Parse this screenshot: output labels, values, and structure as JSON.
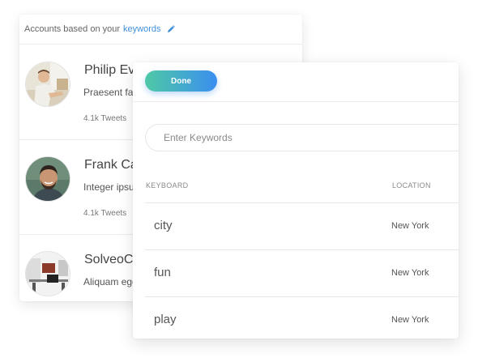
{
  "accounts": {
    "header_prefix": "Accounts based on your",
    "header_link": "keywords",
    "items": [
      {
        "name": "Philip Ev",
        "desc": "Praesent fa",
        "tweets": "4.1k Tweets"
      },
      {
        "name": "Frank Ca",
        "desc": "Integer ipsu",
        "tweets": "4.1k Tweets"
      },
      {
        "name": "SolveoC",
        "desc": "Aliquam ege",
        "tweets": ""
      }
    ]
  },
  "keywords_panel": {
    "done_label": "Done",
    "input_placeholder": "Enter Keywords",
    "col_keyword": "KEYBOARD",
    "col_location": "LOCATION",
    "rows": [
      {
        "keyword": "city",
        "location": "New York"
      },
      {
        "keyword": "fun",
        "location": "New York"
      },
      {
        "keyword": "play",
        "location": "New York"
      }
    ]
  },
  "colors": {
    "accent_link": "#3f8fd8",
    "button_gradient_start": "#4ec9a5",
    "button_gradient_end": "#3b8ef0"
  }
}
